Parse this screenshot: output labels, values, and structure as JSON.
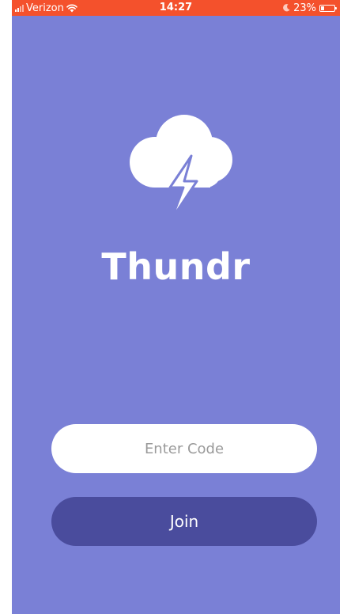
{
  "status_bar": {
    "carrier": "Verizon",
    "time": "14:27",
    "battery": "23%",
    "battery_level": 0.23,
    "background_color": "#f4512c",
    "icons": [
      "signal-icon",
      "wifi-icon",
      "moon-icon",
      "battery-icon"
    ]
  },
  "app": {
    "name": "Thundr",
    "background_color": "#7a80d6",
    "logo_icon": "thunder-cloud-icon"
  },
  "form": {
    "code_placeholder": "Enter Code",
    "code_value": "",
    "join_label": "Join",
    "join_color": "#4a4c9d"
  }
}
